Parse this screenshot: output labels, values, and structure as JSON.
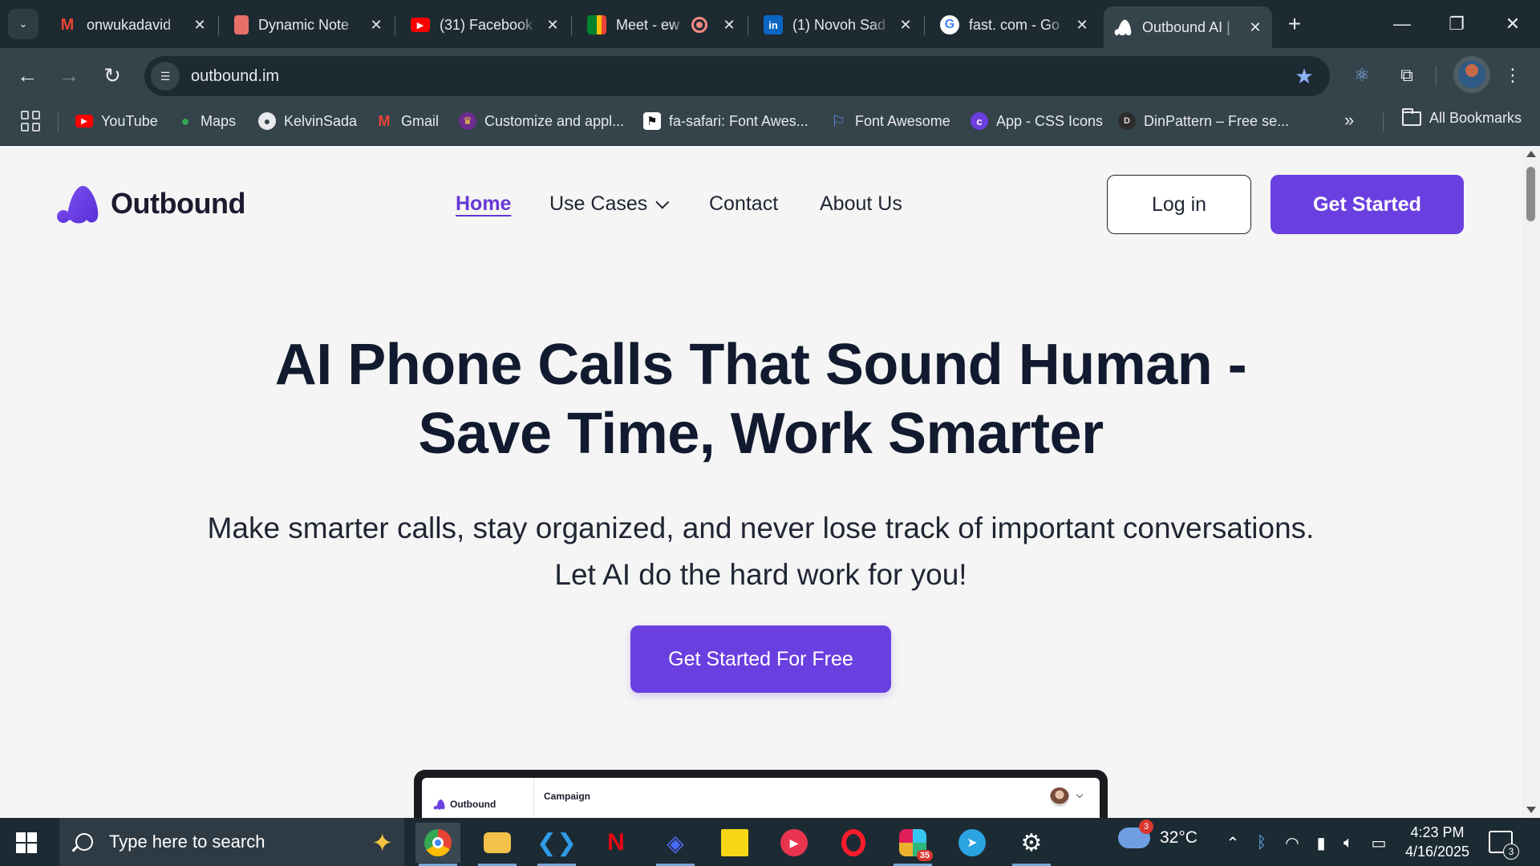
{
  "browser": {
    "tabs": [
      {
        "title": "onwukadavid",
        "favicon": "gmail-icon",
        "color": "#ea4335",
        "glyph": "M"
      },
      {
        "title": "Dynamic Note",
        "favicon": "notes-app-icon",
        "color": "#e8706b",
        "glyph": "▮"
      },
      {
        "title": "(31) Facebook",
        "favicon": "youtube-icon",
        "color": "#ff0000",
        "glyph": "▶"
      },
      {
        "title": "Meet - ew",
        "favicon": "google-meet-icon",
        "color": "#00897b",
        "glyph": "▶"
      },
      {
        "title": "(1) Novoh Sad",
        "favicon": "linkedin-icon",
        "color": "#0a66c2",
        "glyph": "in"
      },
      {
        "title": "fast. com - Go",
        "favicon": "google-icon",
        "color": "#ffffff",
        "glyph": "G"
      },
      {
        "title": "Outbound AI |",
        "favicon": "outbound-icon",
        "color": "#ffffff",
        "glyph": "▲"
      }
    ],
    "url": "outbound.im",
    "bookmarks": [
      {
        "label": "YouTube",
        "icon": "youtube-icon",
        "color": "#ff0000",
        "glyph": "▶"
      },
      {
        "label": "Maps",
        "icon": "google-maps-icon",
        "color": "#34a853",
        "glyph": "●"
      },
      {
        "label": "KelvinSada",
        "icon": "github-icon",
        "color": "#e8eaed",
        "glyph": "◉"
      },
      {
        "label": "Gmail",
        "icon": "gmail-icon",
        "color": "#ea4335",
        "glyph": "M"
      },
      {
        "label": "Customize and appl...",
        "icon": "crown-icon",
        "color": "#6b2b8f",
        "glyph": "♛"
      },
      {
        "label": "fa-safari: Font Awes...",
        "icon": "flag-icon",
        "color": "#ffffff",
        "glyph": "⚑"
      },
      {
        "label": "Font Awesome",
        "icon": "font-awesome-flag-icon",
        "color": "#538dd7",
        "glyph": "⚐"
      },
      {
        "label": "App - CSS Icons",
        "icon": "css-icons-icon",
        "color": "#6c3fe0",
        "glyph": "c"
      },
      {
        "label": "DinPattern – Free se...",
        "icon": "dinpattern-icon",
        "color": "#2c2c2c",
        "glyph": "D"
      }
    ],
    "all_bookmarks": "All Bookmarks"
  },
  "site": {
    "brand": "Outbound",
    "brand_color": "#6a3fe0",
    "nav": {
      "home": "Home",
      "use_cases": "Use Cases",
      "contact": "Contact",
      "about": "About Us"
    },
    "login": "Log in",
    "get_started": "Get Started",
    "hero": {
      "title_line1": "AI Phone Calls That Sound Human -",
      "title_line2": "Save Time, Work Smarter",
      "subtitle_line1": "Make smarter calls, stay organized, and never lose track of important conversations.",
      "subtitle_line2": "Let AI do the hard work for you!",
      "cta": "Get Started For Free"
    },
    "preview": {
      "brand": "Outbound",
      "title": "Campaign"
    }
  },
  "taskbar": {
    "search_placeholder": "Type here to search",
    "weather": "32°C",
    "weather_badge": "3",
    "time": "4:23 PM",
    "date": "4/16/2025",
    "notifications": "3",
    "slack_badge": "35"
  }
}
